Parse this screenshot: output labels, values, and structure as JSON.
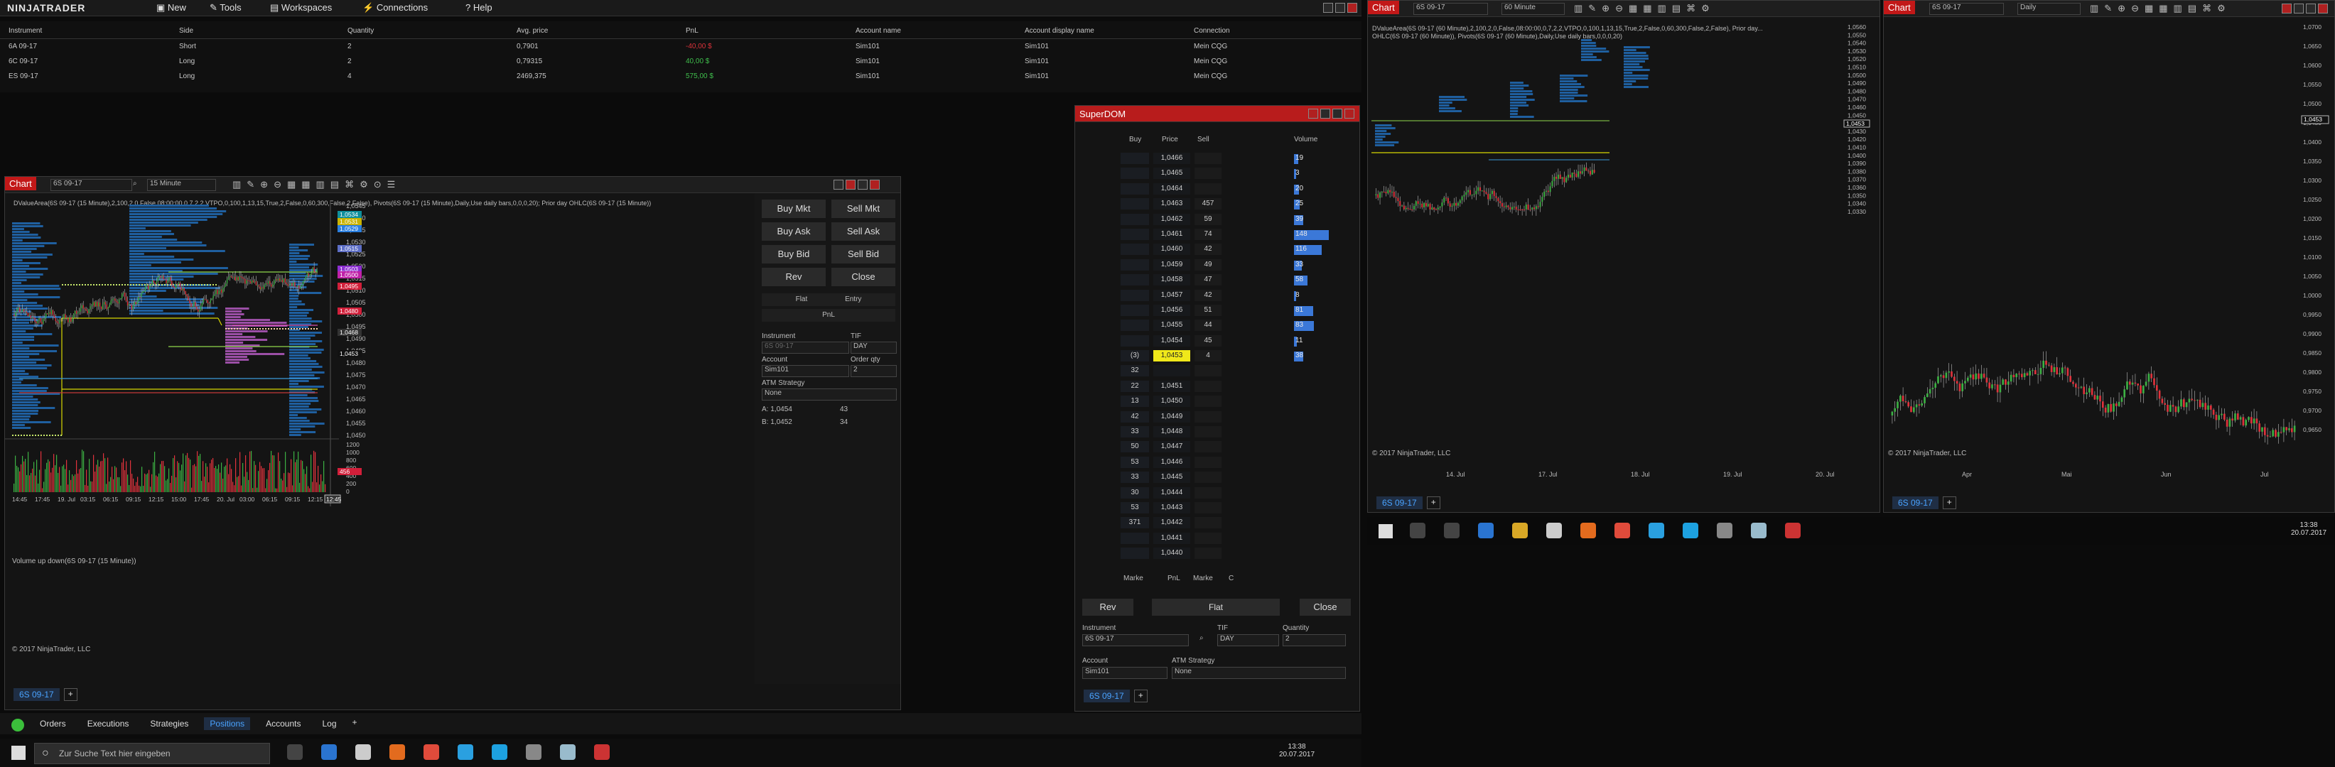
{
  "app": {
    "logo": "NINJATRADER",
    "menu": [
      "New",
      "Tools",
      "Workspaces",
      "Connections",
      "Help"
    ]
  },
  "positions": {
    "headers": [
      "Instrument",
      "Side",
      "Quantity",
      "Avg. price",
      "PnL",
      "Account name",
      "Account display name",
      "Connection"
    ],
    "rows": [
      {
        "instrument": "6A 09-17",
        "side": "Short",
        "quantity": "2",
        "avg": "0,7901",
        "pnl": "-40,00 $",
        "account": "Sim101",
        "display": "Sim101",
        "conn": "Mein CQG"
      },
      {
        "instrument": "6C 09-17",
        "side": "Long",
        "quantity": "2",
        "avg": "0,79315",
        "pnl": "40,00 $",
        "account": "Sim101",
        "display": "Sim101",
        "conn": "Mein CQG"
      },
      {
        "instrument": "ES 09-17",
        "side": "Long",
        "quantity": "4",
        "avg": "2469,375",
        "pnl": "575,00 $",
        "account": "Sim101",
        "display": "Sim101",
        "conn": "Mein CQG"
      }
    ],
    "colors": {
      "neg": "#d9323a",
      "pos": "#3fbf4c"
    }
  },
  "chart1": {
    "label": "Chart",
    "instrument": "6S 09-17",
    "interval": "15 Minute",
    "info": "DValueArea(6S 09-17 (15 Minute),2,100,2,0,False,08:00:00,0,7,2,2,VTPO,0,100,1,13,15,True,2,False,0,60,300,False,2,False), Pivots(6S 09-17 (15 Minute),Daily,Use daily bars,0,0,0,20); Prior day OHLC(6S 09-17 (15 Minute))",
    "price_labels": [
      "1,0545",
      "1,0540",
      "1,0535",
      "1,0530",
      "1,0525",
      "1,0520",
      "1,0515",
      "1,0510",
      "1,0505",
      "1,0500",
      "1,0495",
      "1,0490",
      "1,0485",
      "1,0480",
      "1,0475",
      "1,0470",
      "1,0465",
      "1,0460",
      "1,0455",
      "1,0450"
    ],
    "tags": [
      {
        "text": "1,0534",
        "color": "#0f8f9c"
      },
      {
        "text": "1,0531",
        "color": "#c9b200"
      },
      {
        "text": "1,0529",
        "color": "#2a7fe0"
      },
      {
        "text": "1,0515",
        "color": "#5d6ec6"
      },
      {
        "text": "1,0503",
        "color": "#8c2fd0"
      },
      {
        "text": "1,0500",
        "color": "#c021a8"
      },
      {
        "text": "1,0495",
        "color": "#d21f3a"
      },
      {
        "text": "1,0480",
        "color": "#d21f3a"
      },
      {
        "text": "1,0468",
        "color": "#333"
      },
      {
        "text": "1,0453",
        "color": "#111"
      }
    ],
    "time_labels": [
      "14:45",
      "17:45",
      "19. Jul",
      "03:15",
      "06:15",
      "09:15",
      "12:15",
      "15:00",
      "17:45",
      "20. Jul",
      "03:00",
      "06:15",
      "09:15",
      "12:15"
    ],
    "time_tag": "12:45",
    "volume_title": "Volume up down(6S 09-17 (15 Minute))",
    "volume_labels": [
      "1200",
      "1000",
      "800",
      "600",
      "400",
      "200",
      "0"
    ],
    "volume_tag": "456",
    "copyright": "© 2017 NinjaTrader, LLC",
    "tab": "6S 09-17"
  },
  "chart_trader": {
    "buttons": [
      "Buy Mkt",
      "Sell Mkt",
      "Buy Ask",
      "Sell Ask",
      "Buy Bid",
      "Sell Bid",
      "Rev",
      "Close"
    ],
    "pos_flat": "Flat",
    "pos_entry": "Entry",
    "pnl": "PnL",
    "instrument_label": "Instrument",
    "instrument_value": "6S 09-17",
    "tif_label": "TIF",
    "tif_value": "DAY",
    "account_label": "Account",
    "account_value": "Sim101",
    "qty_label": "Order qty",
    "qty_value": "2",
    "atm_label": "ATM Strategy",
    "atm_value": "None",
    "ask": "A:  1,0454",
    "ask_size": "43",
    "bid": "B:  1,0452",
    "bid_size": "34"
  },
  "superdom": {
    "title": "SuperDOM",
    "headers": [
      "Buy",
      "Price",
      "Sell",
      "Volume"
    ],
    "rows": [
      {
        "buy": "",
        "price": "1,0466",
        "sell": "",
        "vol": "19"
      },
      {
        "buy": "",
        "price": "1,0465",
        "sell": "",
        "vol": "3"
      },
      {
        "buy": "",
        "price": "1,0464",
        "sell": "",
        "vol": "20"
      },
      {
        "buy": "",
        "price": "1,0463",
        "sell": "457",
        "vol": "25"
      },
      {
        "buy": "",
        "price": "1,0462",
        "sell": "59",
        "vol": "39"
      },
      {
        "buy": "",
        "price": "1,0461",
        "sell": "74",
        "vol": "148"
      },
      {
        "buy": "",
        "price": "1,0460",
        "sell": "42",
        "vol": "116"
      },
      {
        "buy": "",
        "price": "1,0459",
        "sell": "49",
        "vol": "33"
      },
      {
        "buy": "",
        "price": "1,0458",
        "sell": "47",
        "vol": "58"
      },
      {
        "buy": "",
        "price": "1,0457",
        "sell": "42",
        "vol": "8"
      },
      {
        "buy": "",
        "price": "1,0456",
        "sell": "51",
        "vol": "81"
      },
      {
        "buy": "",
        "price": "1,0455",
        "sell": "44",
        "vol": "83"
      },
      {
        "buy": "",
        "price": "1,0454",
        "sell": "45",
        "vol": "11"
      },
      {
        "buy": "(3)",
        "price": "1,0453",
        "sell": "4",
        "vol": "38"
      },
      {
        "buy": "32",
        "price": "",
        "sell": "",
        "vol": ""
      },
      {
        "buy": "22",
        "price": "1,0451",
        "sell": "",
        "vol": ""
      },
      {
        "buy": "13",
        "price": "1,0450",
        "sell": "",
        "vol": ""
      },
      {
        "buy": "42",
        "price": "1,0449",
        "sell": "",
        "vol": ""
      },
      {
        "buy": "33",
        "price": "1,0448",
        "sell": "",
        "vol": ""
      },
      {
        "buy": "50",
        "price": "1,0447",
        "sell": "",
        "vol": ""
      },
      {
        "buy": "53",
        "price": "1,0446",
        "sell": "",
        "vol": ""
      },
      {
        "buy": "33",
        "price": "1,0445",
        "sell": "",
        "vol": ""
      },
      {
        "buy": "30",
        "price": "1,0444",
        "sell": "",
        "vol": ""
      },
      {
        "buy": "53",
        "price": "1,0443",
        "sell": "",
        "vol": ""
      },
      {
        "buy": "371",
        "price": "1,0442",
        "sell": "",
        "vol": ""
      },
      {
        "buy": "",
        "price": "1,0441",
        "sell": "",
        "vol": ""
      },
      {
        "buy": "",
        "price": "1,0440",
        "sell": "",
        "vol": ""
      }
    ],
    "footer": [
      "Marke",
      "PnL",
      "Marke",
      "C"
    ],
    "rev": "Rev",
    "flat": "Flat",
    "close": "Close",
    "instrument_label": "Instrument",
    "instrument_value": "6S 09-17",
    "tif_label": "TIF",
    "tif_value": "DAY",
    "qty_label": "Quantity",
    "qty_value": "2",
    "account_label": "Account",
    "account_value": "Sim101",
    "atm_label": "ATM Strategy",
    "atm_value": "None",
    "tab": "6S 09-17"
  },
  "chart2": {
    "label": "Chart",
    "instrument": "6S 09-17",
    "interval": "60 Minute",
    "info1": "DValueArea(6S 09-17 (60 Minute),2,100,2,0,False,08:00:00,0,7,2,2,VTPO,0,100,1,13,15,True,2,False,0,60,300,False,2,False), Prior day...",
    "info2": "OHLC(6S 09-17 (60 Minute)), Pivots(6S 09-17 (60 Minute),Daily,Use daily bars,0,0,0,20)",
    "price_labels": [
      "1,0560",
      "1,0550",
      "1,0540",
      "1,0530",
      "1,0520",
      "1,0510",
      "1,0500",
      "1,0490",
      "1,0480",
      "1,0470",
      "1,0460",
      "1,0450",
      "1,0440",
      "1,0430",
      "1,0420",
      "1,0410",
      "1,0400",
      "1,0390",
      "1,0380",
      "1,0370",
      "1,0360",
      "1,0350",
      "1,0340",
      "1,0330"
    ],
    "tag": "1,0453",
    "time_labels": [
      "14. Jul",
      "17. Jul",
      "18. Jul",
      "19. Jul",
      "20. Jul"
    ],
    "copyright": "© 2017 NinjaTrader, LLC",
    "tab": "6S 09-17"
  },
  "chart3": {
    "label": "Chart",
    "instrument": "6S 09-17",
    "interval": "Daily",
    "price_labels": [
      "1,0700",
      "1,0650",
      "1,0600",
      "1,0550",
      "1,0500",
      "1,0450",
      "1,0400",
      "1,0350",
      "1,0300",
      "1,0250",
      "1,0200",
      "1,0150",
      "1,0100",
      "1,0050",
      "1,0000",
      "0,9950",
      "0,9900",
      "0,9850",
      "0,9800",
      "0,9750",
      "0,9700",
      "0,9650"
    ],
    "tag": "1,0453",
    "time_labels": [
      "Apr",
      "Mai",
      "Jun",
      "Jul"
    ],
    "copyright": "© 2017 NinjaTrader, LLC",
    "tab": "6S 09-17"
  },
  "cc_tabs": [
    "Orders",
    "Executions",
    "Strategies",
    "Positions",
    "Accounts",
    "Log"
  ],
  "taskbar1": {
    "search": "Zur Suche Text hier eingeben",
    "time": "13:38",
    "date": "20.07.2017"
  },
  "taskbar2": {
    "time": "13:38",
    "date": "20.07.2017"
  }
}
